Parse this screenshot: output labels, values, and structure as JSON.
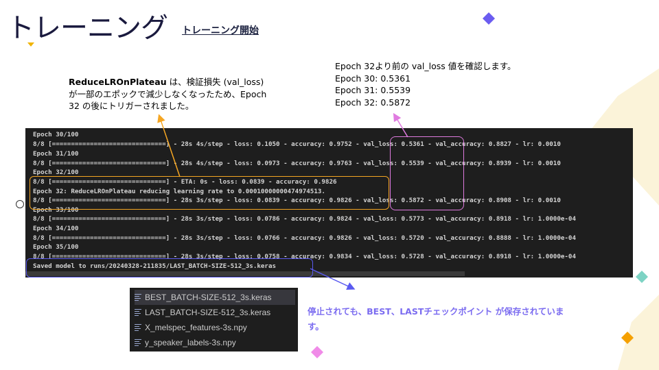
{
  "slide": {
    "title": "トレーニング",
    "subtitle": "トレーニング開始"
  },
  "notes": {
    "left_bold": "ReduceLROnPlateau",
    "left_rest": " は、検証損失 (val_loss) が一部のエポックで減少しなくなったため、Epoch 32 の後にトリガーされました。",
    "right_lines": [
      "Epoch 32より前の val_loss 値を確認します。",
      "Epoch 30: 0.5361",
      "Epoch 31: 0.5539",
      "Epoch 32: 0.5872"
    ],
    "bottom": "停止されても、BEST、LASTチェックポイント が保存されています。"
  },
  "terminal": {
    "lines": [
      "Epoch 30/100",
      "8/8 [==============================] - 28s 4s/step - loss: 0.1050 - accuracy: 0.9752 - val_loss: 0.5361 - val_accuracy: 0.8827 - lr: 0.0010",
      "Epoch 31/100",
      "8/8 [==============================] - 28s 4s/step - loss: 0.0973 - accuracy: 0.9763 - val_loss: 0.5539 - val_accuracy: 0.8939 - lr: 0.0010",
      "Epoch 32/100",
      "8/8 [==============================] - ETA: 0s - loss: 0.0839 - accuracy: 0.9826",
      "Epoch 32: ReduceLROnPlateau reducing learning rate to 0.00010000000474974513.",
      "8/8 [==============================] - 28s 3s/step - loss: 0.0839 - accuracy: 0.9826 - val_loss: 0.5872 - val_accuracy: 0.8908 - lr: 0.0010",
      "Epoch 33/100",
      "8/8 [==============================] - 28s 3s/step - loss: 0.0786 - accuracy: 0.9824 - val_loss: 0.5773 - val_accuracy: 0.8918 - lr: 1.0000e-04",
      "Epoch 34/100",
      "8/8 [==============================] - 28s 3s/step - loss: 0.0766 - accuracy: 0.9826 - val_loss: 0.5720 - val_accuracy: 0.8888 - lr: 1.0000e-04",
      "Epoch 35/100",
      "8/8 [==============================] - 28s 3s/step - loss: 0.0758 - accuracy: 0.9834 - val_loss: 0.5728 - val_accuracy: 0.8918 - lr: 1.0000e-04",
      "Saved model to runs/20240328-211835/LAST_BATCH-SIZE-512_3s.keras"
    ]
  },
  "files": {
    "items": [
      "BEST_BATCH-SIZE-512_3s.keras",
      "LAST_BATCH-SIZE-512_3s.keras",
      "X_melspec_features-3s.npy",
      "y_speaker_labels-3s.npy"
    ],
    "icon": "file-lines-icon"
  },
  "colors": {
    "orange": "#f5a623",
    "pink": "#e07be0",
    "blue": "#5a5af0",
    "purple_diamond": "#6b5cf0",
    "teal_diamond": "#7dd3c4",
    "magenta_diamond": "#f08be8",
    "orange_diamond": "#f5a000",
    "cream_shape": "#fbf3d9"
  }
}
